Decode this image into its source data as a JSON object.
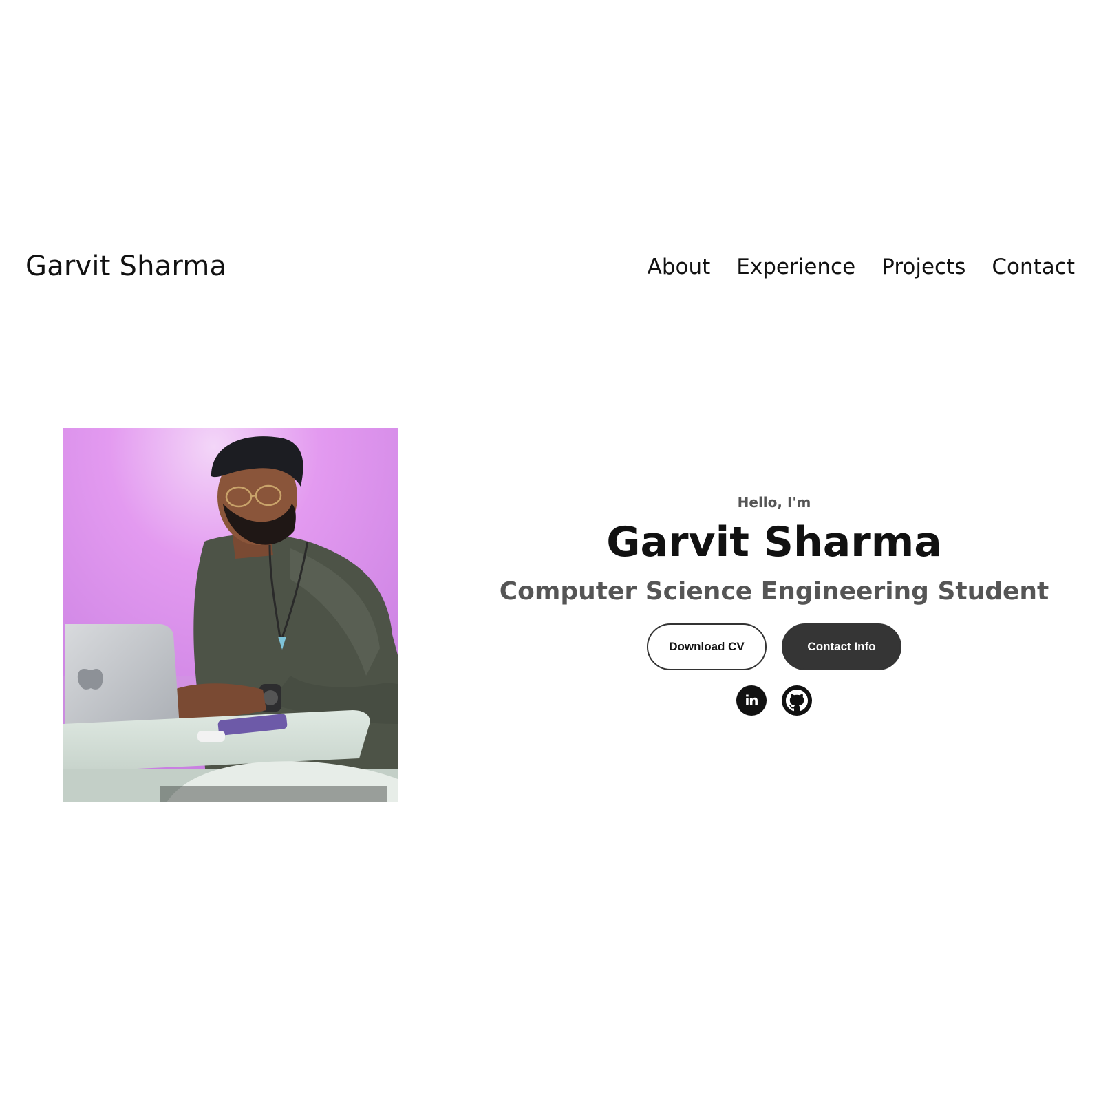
{
  "header": {
    "logo": "Garvit Sharma",
    "nav": [
      {
        "label": "About"
      },
      {
        "label": "Experience"
      },
      {
        "label": "Projects"
      },
      {
        "label": "Contact"
      }
    ]
  },
  "hero": {
    "photo_alt": "profile-photo",
    "greeting": "Hello, I'm",
    "name": "Garvit Sharma",
    "role": "Computer Science Engineering Student",
    "buttons": {
      "download_cv": "Download CV",
      "contact_info": "Contact Info"
    },
    "socials": [
      {
        "icon": "linkedin-icon",
        "glyph": "in"
      },
      {
        "icon": "github-icon"
      }
    ]
  },
  "colors": {
    "text_dark": "#111111",
    "text_muted": "#555555",
    "button_dark": "#353535",
    "photo_bg": "#d98ae6"
  }
}
